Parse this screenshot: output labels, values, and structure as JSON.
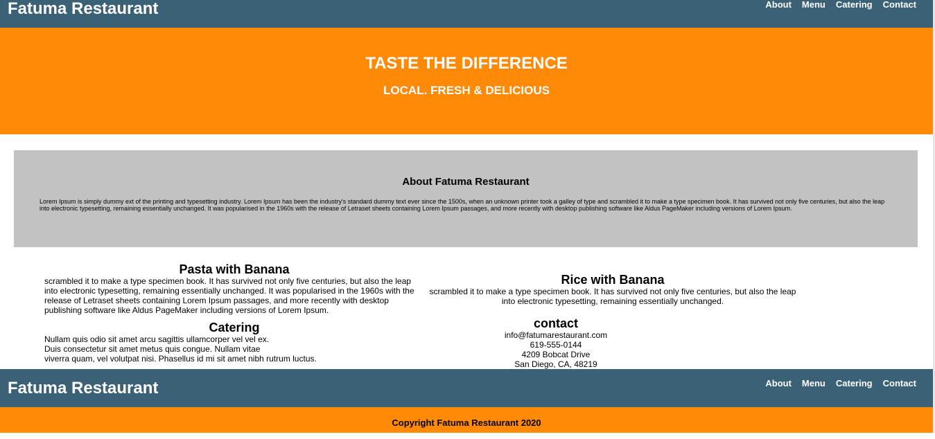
{
  "header": {
    "brand": "Fatuma Restaurant",
    "nav": [
      "About",
      "Menu",
      "Catering",
      "Contact"
    ]
  },
  "hero": {
    "title": "TASTE THE DIFFERENCE",
    "subtitle": "LOCAL. FRESH & DELICIOUS"
  },
  "about": {
    "heading": "About Fatuma Restaurant",
    "body": "Lorem Ipsum is simply dummy ext of the printing and typesetting industry. Lorem Ipsum has been the industry's standard dummy text ever since the 1500s, when an unknown printer took a galley of type and scrambled it to make a type specimen book. It has survived not only five centuries, but also the leap into electronic typesetting, remaining essentially unchanged. It was popularised in the 1960s with the release of Letraset sheets containing Lorem Ipsum passages, and more recently with desktop publishing software like Aldus PageMaker including versions of Lorem Ipsum."
  },
  "sections": {
    "pasta": {
      "heading": "Pasta with Banana",
      "body": "scrambled it to make a type specimen book. It has survived not only five centuries, but also the leap into electronic typesetting, remaining essentially unchanged. It was popularised in the 1960s with the release of Letraset sheets containing Lorem Ipsum passages, and more recently with desktop publishing software like Aldus PageMaker including versions of Lorem Ipsum."
    },
    "rice": {
      "heading": "Rice with Banana",
      "body": "scrambled it to make a type specimen book. It has survived not only five centuries, but also the leap into electronic typesetting, remaining essentially unchanged."
    },
    "catering": {
      "heading": "Catering",
      "line1": "Nullam quis odio sit amet arcu sagittis ullamcorper vel vel ex.",
      "line2": "Duis consectetur sit amet metus quis congue. Nullam vitae",
      "line3": "viverra quam, vel volutpat nisi. Phasellus id mi sit amet nibh rutrum luctus."
    },
    "contact": {
      "heading": "contact",
      "email": "info@fatumarestaurant.com",
      "phone": "619-555-0144",
      "street": "4209 Bobcat Drive",
      "city": "San Diego, CA, 48219"
    }
  },
  "footer": {
    "brand": "Fatuma Restaurant",
    "nav": [
      "About",
      "Menu",
      "Catering",
      "Contact"
    ],
    "copyright": "Copyright Fatuma Restaurant 2020"
  },
  "colors": {
    "bar": "#3a6176",
    "accent": "#ff8a07",
    "about_bg": "#c2c2c2"
  }
}
